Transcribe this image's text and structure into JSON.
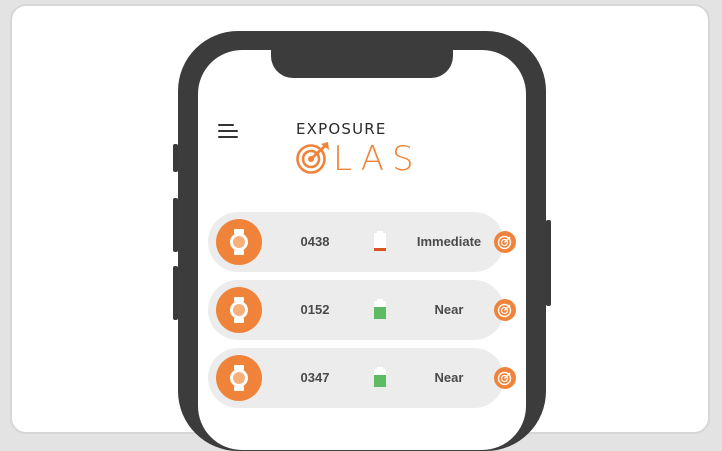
{
  "app": {
    "logo_top": "EXPOSURE",
    "logo_bottom": "LAS",
    "accent_color": "#f0833a"
  },
  "icons": {
    "menu": "hamburger-icon",
    "device": "watch-icon",
    "battery": "battery-icon",
    "target": "target-icon"
  },
  "devices": [
    {
      "id": "0438",
      "status": "Immediate",
      "battery_level": "low",
      "battery_color": "#d9541e"
    },
    {
      "id": "0152",
      "status": "Near",
      "battery_level": "high",
      "battery_color": "#5dbb63"
    },
    {
      "id": "0347",
      "status": "Near",
      "battery_level": "high",
      "battery_color": "#5dbb63"
    }
  ]
}
